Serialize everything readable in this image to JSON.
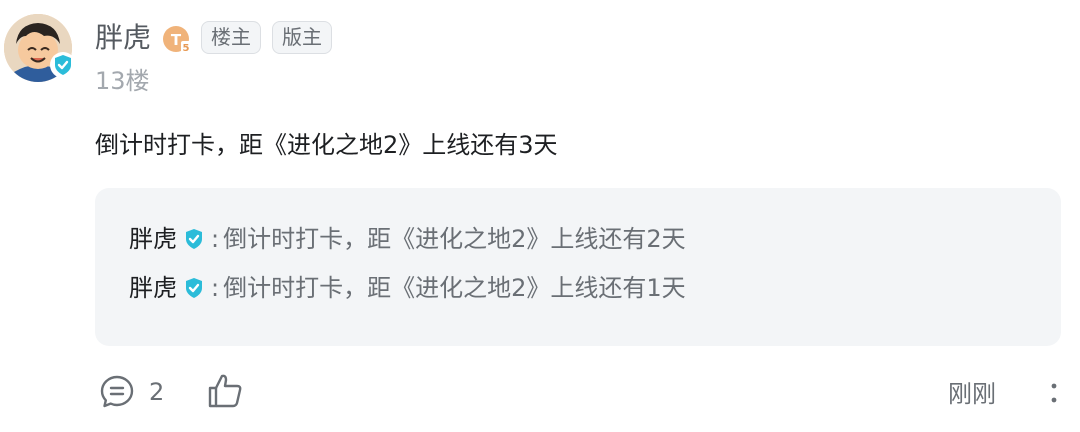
{
  "post": {
    "author": {
      "name": "胖虎",
      "avatar_icon": "cartoon-boy-avatar",
      "verified_icon": "verified-check-icon",
      "level_icon": "level-badge-icon",
      "level_letter": "T",
      "level_number": "5",
      "tags": [
        "楼主",
        "版主"
      ]
    },
    "floor": "13楼",
    "content": "倒计时打卡，距《进化之地2》上线还有3天",
    "replies": [
      {
        "author": "胖虎",
        "separator": ":",
        "text": "倒计时打卡，距《进化之地2》上线还有2天"
      },
      {
        "author": "胖虎",
        "separator": ":",
        "text": "倒计时打卡，距《进化之地2》上线还有1天"
      }
    ],
    "actions": {
      "comment_icon": "comment-icon",
      "comment_count": "2",
      "like_icon": "thumbs-up-icon",
      "time": "刚刚",
      "more_icon": "more-vertical-icon"
    }
  },
  "colors": {
    "verified": "#2bbcd9",
    "level_badge": "#f0b37a",
    "reply_bg": "#f3f5f7",
    "muted_text": "#6a6f75",
    "floor_text": "#a3a8ae"
  }
}
